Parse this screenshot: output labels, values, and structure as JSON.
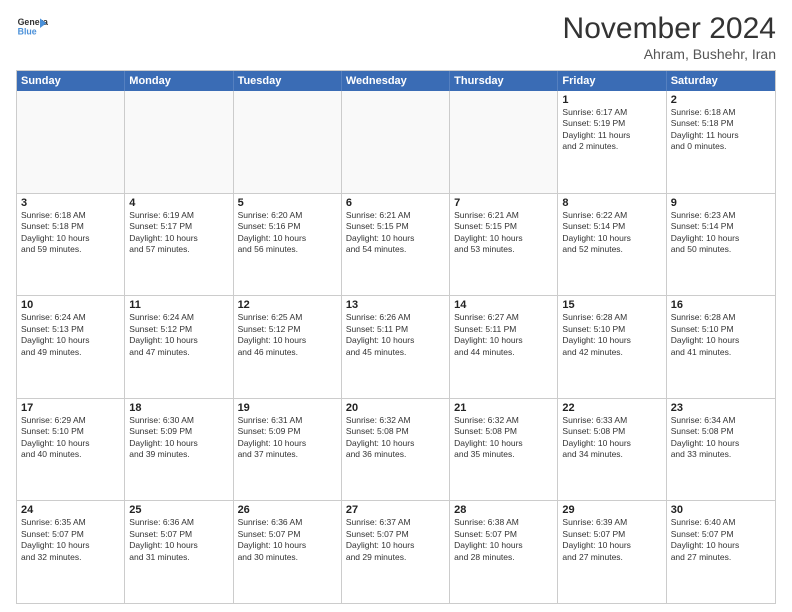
{
  "logo": {
    "line1": "General",
    "line2": "Blue"
  },
  "title": "November 2024",
  "location": "Ahram, Bushehr, Iran",
  "days_of_week": [
    "Sunday",
    "Monday",
    "Tuesday",
    "Wednesday",
    "Thursday",
    "Friday",
    "Saturday"
  ],
  "weeks": [
    [
      {
        "day": "",
        "info": "",
        "empty": true
      },
      {
        "day": "",
        "info": "",
        "empty": true
      },
      {
        "day": "",
        "info": "",
        "empty": true
      },
      {
        "day": "",
        "info": "",
        "empty": true
      },
      {
        "day": "",
        "info": "",
        "empty": true
      },
      {
        "day": "1",
        "info": "Sunrise: 6:17 AM\nSunset: 5:19 PM\nDaylight: 11 hours\nand 2 minutes."
      },
      {
        "day": "2",
        "info": "Sunrise: 6:18 AM\nSunset: 5:18 PM\nDaylight: 11 hours\nand 0 minutes."
      }
    ],
    [
      {
        "day": "3",
        "info": "Sunrise: 6:18 AM\nSunset: 5:18 PM\nDaylight: 10 hours\nand 59 minutes."
      },
      {
        "day": "4",
        "info": "Sunrise: 6:19 AM\nSunset: 5:17 PM\nDaylight: 10 hours\nand 57 minutes."
      },
      {
        "day": "5",
        "info": "Sunrise: 6:20 AM\nSunset: 5:16 PM\nDaylight: 10 hours\nand 56 minutes."
      },
      {
        "day": "6",
        "info": "Sunrise: 6:21 AM\nSunset: 5:15 PM\nDaylight: 10 hours\nand 54 minutes."
      },
      {
        "day": "7",
        "info": "Sunrise: 6:21 AM\nSunset: 5:15 PM\nDaylight: 10 hours\nand 53 minutes."
      },
      {
        "day": "8",
        "info": "Sunrise: 6:22 AM\nSunset: 5:14 PM\nDaylight: 10 hours\nand 52 minutes."
      },
      {
        "day": "9",
        "info": "Sunrise: 6:23 AM\nSunset: 5:14 PM\nDaylight: 10 hours\nand 50 minutes."
      }
    ],
    [
      {
        "day": "10",
        "info": "Sunrise: 6:24 AM\nSunset: 5:13 PM\nDaylight: 10 hours\nand 49 minutes."
      },
      {
        "day": "11",
        "info": "Sunrise: 6:24 AM\nSunset: 5:12 PM\nDaylight: 10 hours\nand 47 minutes."
      },
      {
        "day": "12",
        "info": "Sunrise: 6:25 AM\nSunset: 5:12 PM\nDaylight: 10 hours\nand 46 minutes."
      },
      {
        "day": "13",
        "info": "Sunrise: 6:26 AM\nSunset: 5:11 PM\nDaylight: 10 hours\nand 45 minutes."
      },
      {
        "day": "14",
        "info": "Sunrise: 6:27 AM\nSunset: 5:11 PM\nDaylight: 10 hours\nand 44 minutes."
      },
      {
        "day": "15",
        "info": "Sunrise: 6:28 AM\nSunset: 5:10 PM\nDaylight: 10 hours\nand 42 minutes."
      },
      {
        "day": "16",
        "info": "Sunrise: 6:28 AM\nSunset: 5:10 PM\nDaylight: 10 hours\nand 41 minutes."
      }
    ],
    [
      {
        "day": "17",
        "info": "Sunrise: 6:29 AM\nSunset: 5:10 PM\nDaylight: 10 hours\nand 40 minutes."
      },
      {
        "day": "18",
        "info": "Sunrise: 6:30 AM\nSunset: 5:09 PM\nDaylight: 10 hours\nand 39 minutes."
      },
      {
        "day": "19",
        "info": "Sunrise: 6:31 AM\nSunset: 5:09 PM\nDaylight: 10 hours\nand 37 minutes."
      },
      {
        "day": "20",
        "info": "Sunrise: 6:32 AM\nSunset: 5:08 PM\nDaylight: 10 hours\nand 36 minutes."
      },
      {
        "day": "21",
        "info": "Sunrise: 6:32 AM\nSunset: 5:08 PM\nDaylight: 10 hours\nand 35 minutes."
      },
      {
        "day": "22",
        "info": "Sunrise: 6:33 AM\nSunset: 5:08 PM\nDaylight: 10 hours\nand 34 minutes."
      },
      {
        "day": "23",
        "info": "Sunrise: 6:34 AM\nSunset: 5:08 PM\nDaylight: 10 hours\nand 33 minutes."
      }
    ],
    [
      {
        "day": "24",
        "info": "Sunrise: 6:35 AM\nSunset: 5:07 PM\nDaylight: 10 hours\nand 32 minutes."
      },
      {
        "day": "25",
        "info": "Sunrise: 6:36 AM\nSunset: 5:07 PM\nDaylight: 10 hours\nand 31 minutes."
      },
      {
        "day": "26",
        "info": "Sunrise: 6:36 AM\nSunset: 5:07 PM\nDaylight: 10 hours\nand 30 minutes."
      },
      {
        "day": "27",
        "info": "Sunrise: 6:37 AM\nSunset: 5:07 PM\nDaylight: 10 hours\nand 29 minutes."
      },
      {
        "day": "28",
        "info": "Sunrise: 6:38 AM\nSunset: 5:07 PM\nDaylight: 10 hours\nand 28 minutes."
      },
      {
        "day": "29",
        "info": "Sunrise: 6:39 AM\nSunset: 5:07 PM\nDaylight: 10 hours\nand 27 minutes."
      },
      {
        "day": "30",
        "info": "Sunrise: 6:40 AM\nSunset: 5:07 PM\nDaylight: 10 hours\nand 27 minutes."
      }
    ]
  ]
}
